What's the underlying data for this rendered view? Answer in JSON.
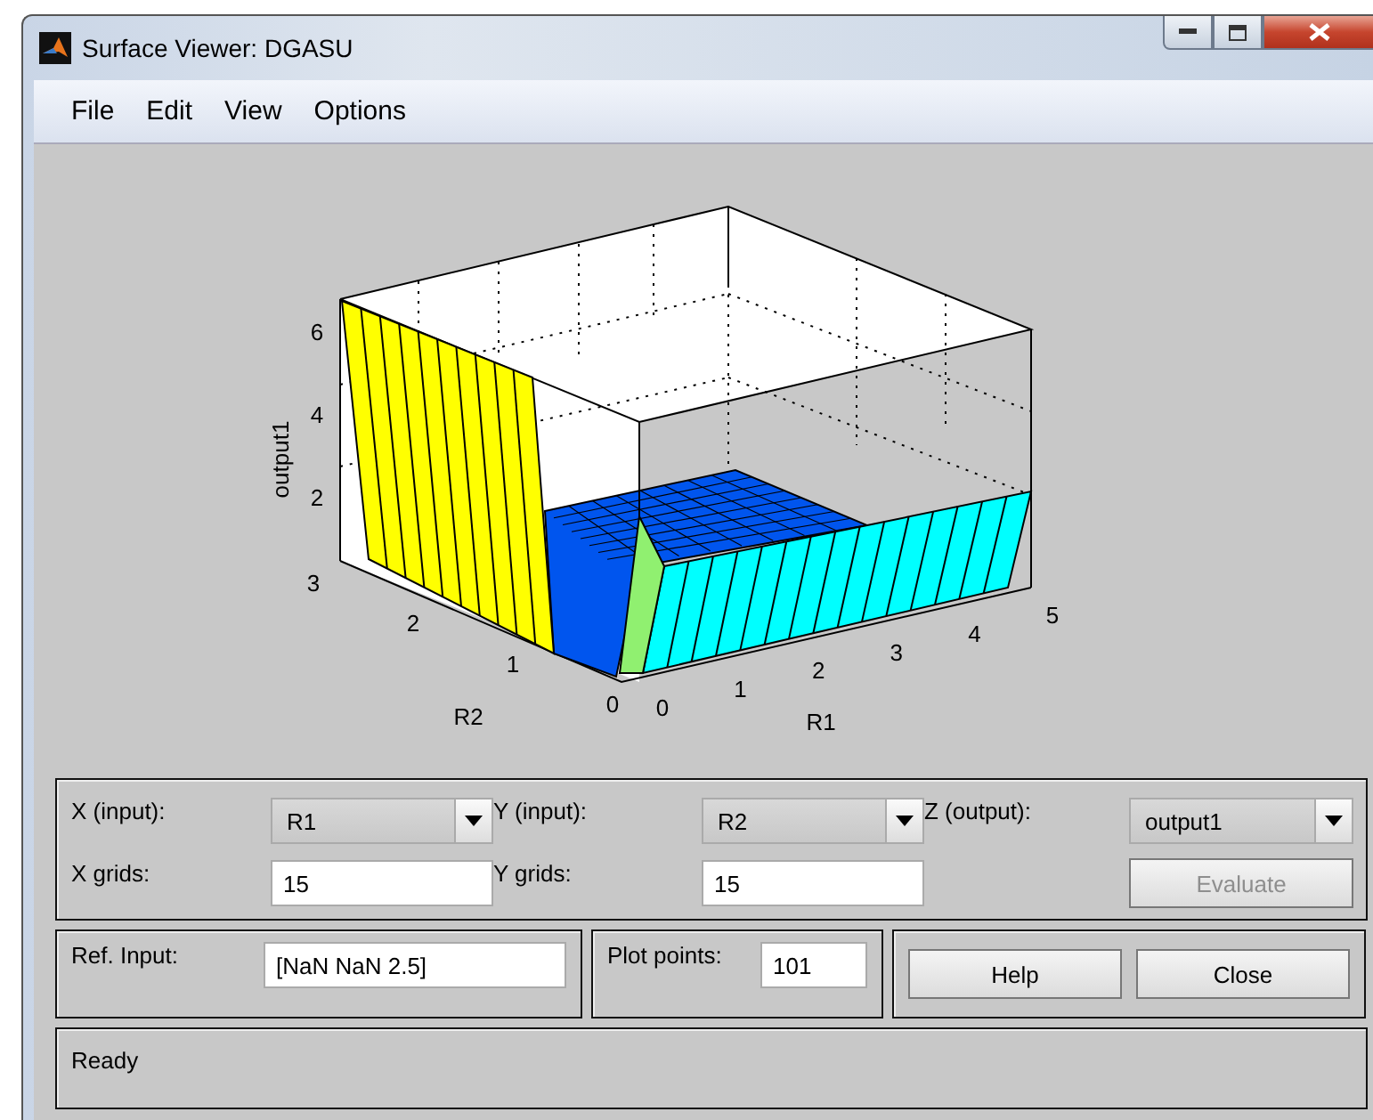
{
  "window": {
    "title": "Surface Viewer: DGASU"
  },
  "menu": [
    "File",
    "Edit",
    "View",
    "Options"
  ],
  "plot": {
    "zlabel": "output1",
    "xlabel": "R1",
    "ylabel": "R2",
    "xticks": [
      "0",
      "1",
      "2",
      "3",
      "4",
      "5"
    ],
    "yticks": [
      "0",
      "1",
      "2",
      "3"
    ],
    "zticks": [
      "6",
      "4",
      "2"
    ]
  },
  "selectors": [
    {
      "label": "X (input):",
      "value": "R1"
    },
    {
      "label": "Y (input):",
      "value": "R2"
    },
    {
      "label": "Z (output):",
      "value": "output1"
    }
  ],
  "grids": [
    {
      "label": "X grids:",
      "value": "15"
    },
    {
      "label": "Y grids:",
      "value": "15"
    }
  ],
  "evaluate": {
    "label": "Evaluate",
    "disabled": true
  },
  "ref_input": {
    "label": "Ref. Input:",
    "value": "[NaN NaN 2.5]"
  },
  "plot_points": {
    "label": "Plot points:",
    "value": "101"
  },
  "buttons": [
    "Help",
    "Close"
  ],
  "status": "Ready"
}
